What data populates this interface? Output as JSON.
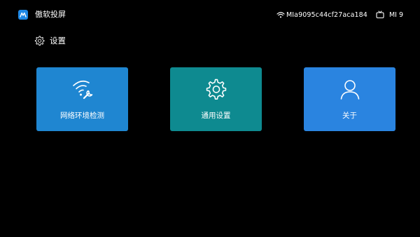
{
  "app": {
    "title": "傲软投屏"
  },
  "status": {
    "network_name": "MIa9095c44cf27aca184",
    "device_name": "MI 9"
  },
  "page": {
    "title": "设置"
  },
  "cards": [
    {
      "label": "网络环境检测",
      "icon": "wifi-wrench-icon",
      "color": "#1f86d1"
    },
    {
      "label": "通用设置",
      "icon": "gear-icon",
      "color": "#0e8a90"
    },
    {
      "label": "关于",
      "icon": "user-icon",
      "color": "#2a84e0"
    }
  ],
  "colors": {
    "background": "#000000",
    "accent": "#1e88e5"
  }
}
